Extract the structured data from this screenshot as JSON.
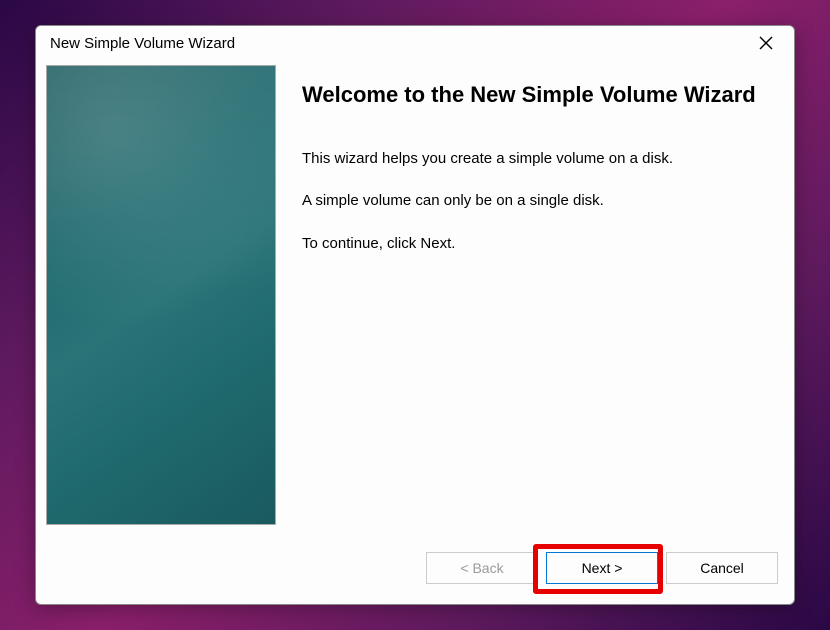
{
  "titleBar": {
    "title": "New Simple Volume Wizard"
  },
  "content": {
    "heading": "Welcome to the New Simple Volume Wizard",
    "line1": "This wizard helps you create a simple volume on a disk.",
    "line2": "A simple volume can only be on a single disk.",
    "line3": "To continue, click Next."
  },
  "buttons": {
    "back": "< Back",
    "next": "Next >",
    "cancel": "Cancel"
  }
}
